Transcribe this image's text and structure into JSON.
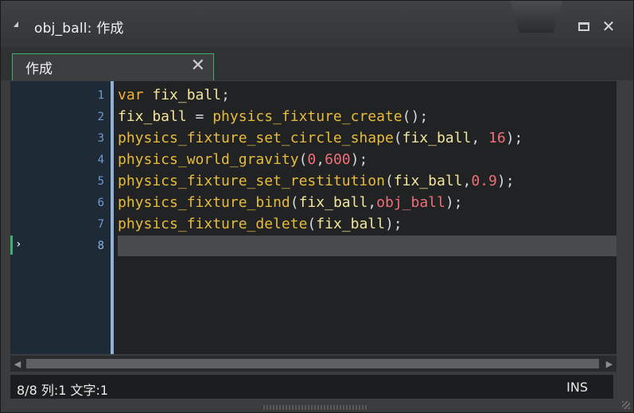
{
  "window": {
    "title": "obj_ball: 作成",
    "collapse_icon": "collapse-triangle-icon",
    "maximize_icon": "maximize-icon",
    "close_icon": "close-icon",
    "close_glyph": "✕"
  },
  "tab": {
    "label": "作成",
    "close_glyph": "✕"
  },
  "editor": {
    "line_numbers": [
      "1",
      "2",
      "3",
      "4",
      "5",
      "6",
      "7",
      "8"
    ],
    "current_line_marker": "›",
    "lines": [
      [
        {
          "t": "kw",
          "v": "var"
        },
        {
          "t": "p",
          "v": " "
        },
        {
          "t": "var",
          "v": "fix_ball"
        },
        {
          "t": "p",
          "v": ";"
        }
      ],
      [
        {
          "t": "var",
          "v": "fix_ball"
        },
        {
          "t": "p",
          "v": " = "
        },
        {
          "t": "fn",
          "v": "physics_fixture_create"
        },
        {
          "t": "p",
          "v": "();"
        }
      ],
      [
        {
          "t": "fn",
          "v": "physics_fixture_set_circle_shape"
        },
        {
          "t": "p",
          "v": "("
        },
        {
          "t": "var",
          "v": "fix_ball"
        },
        {
          "t": "p",
          "v": ", "
        },
        {
          "t": "num",
          "v": "16"
        },
        {
          "t": "p",
          "v": ");"
        }
      ],
      [
        {
          "t": "fn",
          "v": "physics_world_gravity"
        },
        {
          "t": "p",
          "v": "("
        },
        {
          "t": "num",
          "v": "0"
        },
        {
          "t": "p",
          "v": ","
        },
        {
          "t": "num",
          "v": "600"
        },
        {
          "t": "p",
          "v": ");"
        }
      ],
      [
        {
          "t": "fn",
          "v": "physics_fixture_set_restitution"
        },
        {
          "t": "p",
          "v": "("
        },
        {
          "t": "var",
          "v": "fix_ball"
        },
        {
          "t": "p",
          "v": ","
        },
        {
          "t": "num",
          "v": "0.9"
        },
        {
          "t": "p",
          "v": ");"
        }
      ],
      [
        {
          "t": "fn",
          "v": "physics_fixture_bind"
        },
        {
          "t": "p",
          "v": "("
        },
        {
          "t": "var",
          "v": "fix_ball"
        },
        {
          "t": "p",
          "v": ","
        },
        {
          "t": "obj",
          "v": "obj_ball"
        },
        {
          "t": "p",
          "v": ");"
        }
      ],
      [
        {
          "t": "fn",
          "v": "physics_fixture_delete"
        },
        {
          "t": "p",
          "v": "("
        },
        {
          "t": "var",
          "v": "fix_ball"
        },
        {
          "t": "p",
          "v": ");"
        }
      ],
      []
    ]
  },
  "scrollbar": {
    "left_arrow": "◀",
    "right_arrow": "▶"
  },
  "status": {
    "position": "8/8 列:1 文字:1",
    "mode": "INS"
  },
  "colors": {
    "accent_green": "#3fae6f",
    "gutter_bar": "#8fb2d6",
    "keyword": "#f2b233",
    "number": "#f06f77"
  }
}
